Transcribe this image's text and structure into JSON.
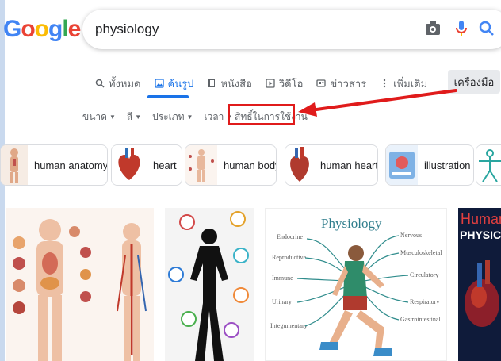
{
  "logo": {
    "g1": "G",
    "o1": "o",
    "o2": "o",
    "g2": "g",
    "l": "l",
    "e": "e"
  },
  "search": {
    "query": "physiology"
  },
  "tabs": [
    {
      "label": "ทั้งหมด",
      "icon": "search-icon"
    },
    {
      "label": "ค้นรูป",
      "icon": "image-icon"
    },
    {
      "label": "หนังสือ",
      "icon": "book-icon"
    },
    {
      "label": "วิดีโอ",
      "icon": "video-icon"
    },
    {
      "label": "ข่าวสาร",
      "icon": "news-icon"
    },
    {
      "label": "เพิ่มเติม",
      "icon": "more-icon"
    }
  ],
  "tools_label": "เครื่องมือ",
  "filters": [
    {
      "label": "ขนาด"
    },
    {
      "label": "สี"
    },
    {
      "label": "ประเภท"
    },
    {
      "label": "เวลา"
    }
  ],
  "rights_label": "สิทธิ์ในการใช้งาน",
  "chips": [
    {
      "label": "human anatomy"
    },
    {
      "label": "heart"
    },
    {
      "label": "human body"
    },
    {
      "label": "human heart"
    },
    {
      "label": "illustration"
    }
  ],
  "results": {
    "tile3": {
      "title": "Physiology",
      "left_labels": [
        "Endocrine",
        "Reproductive",
        "Immune",
        "Urinary",
        "Integumentary"
      ],
      "right_labels": [
        "Nervous",
        "Musculoskeletal",
        "Circulatory",
        "Respiratory",
        "Gastrointestinal"
      ]
    },
    "tile4": {
      "line1": "Human",
      "line2": "PHYSIC"
    }
  },
  "colors": {
    "accent": "#1a73e8",
    "highlight": "#e01b1b"
  }
}
